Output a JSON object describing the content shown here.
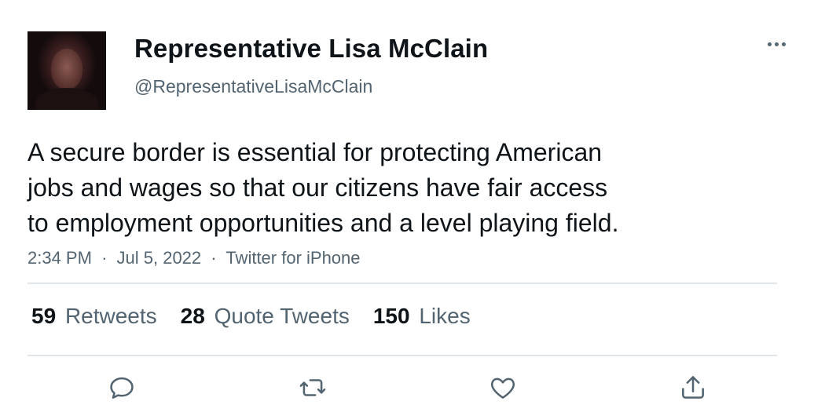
{
  "tweet": {
    "display_name": "Representative Lisa McClain",
    "handle": "@RepresentativeLisaMcClain",
    "text_lines": [
      "A secure border is essential for protecting American",
      "jobs and wages so that our citizens have fair access",
      "to employment opportunities and a level playing field."
    ],
    "time": "2:34 PM",
    "date": "Jul 5, 2022",
    "source": "Twitter for iPhone",
    "separator": "·"
  },
  "stats": {
    "retweets": {
      "count": "59",
      "label": "Retweets"
    },
    "quote_tweets": {
      "count": "28",
      "label": "Quote Tweets"
    },
    "likes": {
      "count": "150",
      "label": "Likes"
    }
  },
  "icons": {
    "more": "more-icon",
    "reply": "reply-icon",
    "retweet": "retweet-icon",
    "like": "like-icon",
    "share": "share-icon"
  },
  "colors": {
    "text_primary": "#0f1419",
    "text_secondary": "#536471",
    "divider": "#e1e6ea",
    "icon": "#536471"
  }
}
